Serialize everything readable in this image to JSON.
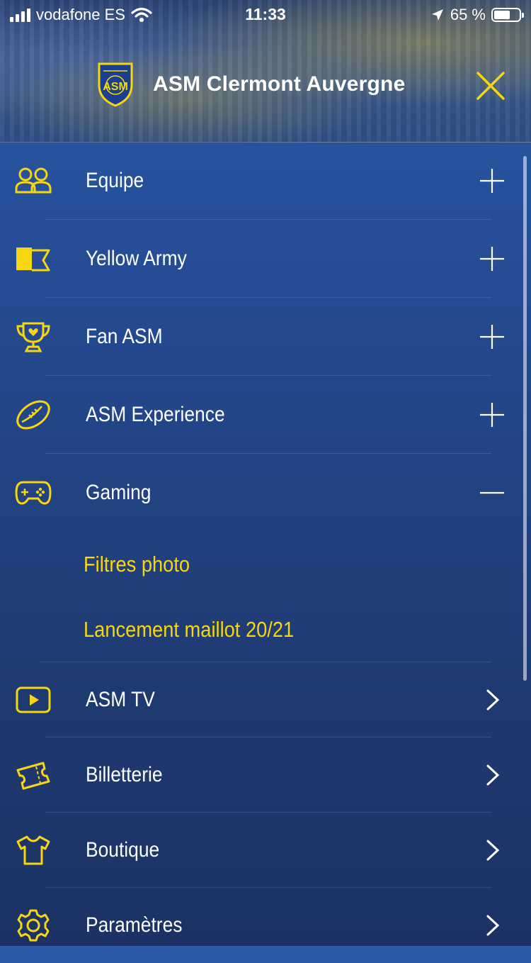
{
  "status_bar": {
    "carrier": "vodafone ES",
    "time": "11:33",
    "battery_percent": "65 %",
    "battery_level": 0.65
  },
  "header": {
    "title": "ASM Clermont Auvergne",
    "logo_text": "ASM",
    "close_icon": "close-x-icon"
  },
  "colors": {
    "accent_yellow": "#f6d612",
    "background_top": "#2a5aa8",
    "background_bottom": "#1c3264"
  },
  "menu": {
    "items": [
      {
        "label": "Equipe",
        "icon": "team-icon",
        "action": "plus"
      },
      {
        "label": "Yellow Army",
        "icon": "flag-icon",
        "action": "plus"
      },
      {
        "label": "Fan ASM",
        "icon": "trophy-icon",
        "action": "plus"
      },
      {
        "label": "ASM Experience",
        "icon": "rugby-ball-icon",
        "action": "plus"
      },
      {
        "label": "Gaming",
        "icon": "gamepad-icon",
        "action": "minus",
        "subitems": [
          "Filtres photo",
          "Lancement maillot 20/21"
        ]
      },
      {
        "label": "ASM TV",
        "icon": "play-icon",
        "action": "chevron"
      },
      {
        "label": "Billetterie",
        "icon": "ticket-icon",
        "action": "chevron"
      },
      {
        "label": "Boutique",
        "icon": "shirt-icon",
        "action": "chevron"
      },
      {
        "label": "Paramètres",
        "icon": "gear-icon",
        "action": "chevron"
      }
    ]
  }
}
